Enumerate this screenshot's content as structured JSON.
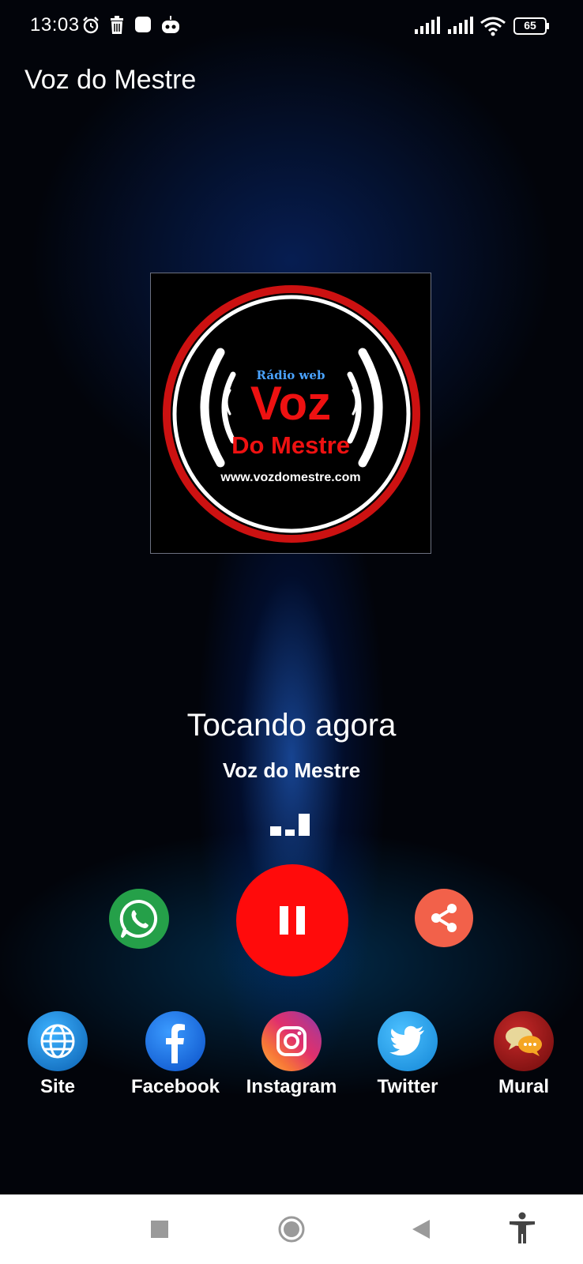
{
  "status_bar": {
    "time": "13:03",
    "battery": "65",
    "icons": [
      "alarm-icon",
      "trash-icon",
      "app-icon",
      "robot-icon",
      "signal-icon",
      "signal-icon",
      "wifi-icon",
      "battery-icon"
    ]
  },
  "app": {
    "title": "Voz do Mestre"
  },
  "logo": {
    "small_text": "Rádio web",
    "big_text": "Voz",
    "sub_text": "Do Mestre",
    "url": "www.vozdomestre.com",
    "ring_color": "#cc1111"
  },
  "player": {
    "now_playing_label": "Tocando agora",
    "station": "Voz do Mestre",
    "state": "playing"
  },
  "controls": {
    "whatsapp_icon": "whatsapp-icon",
    "play_pause_icon": "pause-icon",
    "share_icon": "share-icon",
    "play_color": "#ff0b0b"
  },
  "social": [
    {
      "label": "Site",
      "icon": "globe-icon",
      "color": "#1a7fd4"
    },
    {
      "label": "Facebook",
      "icon": "facebook-icon",
      "color": "#1877f2"
    },
    {
      "label": "Instagram",
      "icon": "instagram-icon",
      "color": "#e1306c"
    },
    {
      "label": "Twitter",
      "icon": "twitter-icon",
      "color": "#1da1f2"
    },
    {
      "label": "Mural",
      "icon": "chat-bubbles-icon",
      "color": "#b71c1c"
    }
  ],
  "nav": {
    "icons": [
      "recents-square-icon",
      "home-circle-icon",
      "back-triangle-icon",
      "accessibility-icon"
    ]
  }
}
